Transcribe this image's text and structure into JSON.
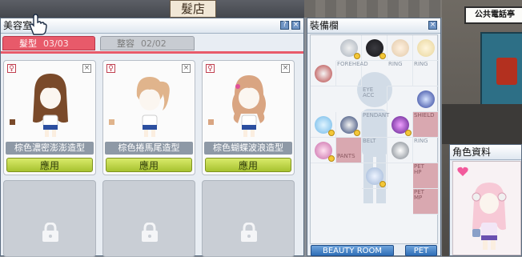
{
  "scene": {
    "shop_sign": "髮店",
    "phone_sign": "公共電話亭"
  },
  "beauty_room": {
    "title": "美容室",
    "tabs": [
      {
        "label": "髮型",
        "count": "03/03",
        "active": true
      },
      {
        "label": "整容",
        "count": "02/02",
        "active": false
      }
    ],
    "cards": [
      {
        "name": "棕色濃密澎澎造型",
        "apply_label": "應用",
        "gender_icon": "female-icon",
        "hair_color": "#7a4a2a",
        "style": "fluffy"
      },
      {
        "name": "棕色捲馬尾造型",
        "apply_label": "應用",
        "gender_icon": "female-icon",
        "hair_color": "#e0b48c",
        "style": "ponytail"
      },
      {
        "name": "棕色蝴蝶波浪造型",
        "apply_label": "應用",
        "gender_icon": "female-icon",
        "hair_color": "#d9a582",
        "style": "wavy"
      }
    ],
    "locked_slots": 3
  },
  "equipment": {
    "title": "裝備欄",
    "slot_labels": {
      "forehead": "FOREHEAD",
      "ring1": "RING",
      "ring2": "RING",
      "eye_acc": "EYE\nACC",
      "pendant": "PENDANT",
      "shield": "SHIELD",
      "belt": "BELT",
      "ring3": "RING",
      "pants": "PANTS",
      "pet_hp": "PET\nHP",
      "pet_mp": "PET\nMP"
    },
    "footer": {
      "beauty_room_button": "BEAUTY ROOM",
      "pet_button": "PET"
    }
  },
  "character_info": {
    "title": "角色資料"
  },
  "colors": {
    "tab_active": "#e85a6a",
    "apply_button": "#b7cf3a",
    "window_frame": "#5a6c80"
  }
}
